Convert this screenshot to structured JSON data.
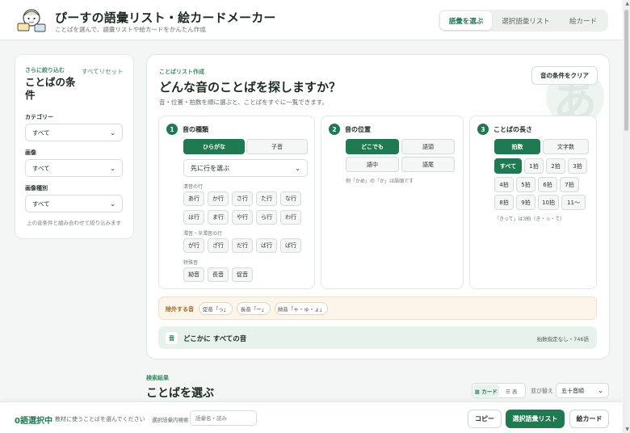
{
  "header": {
    "title": "ぴーすの語彙リスト・絵カードメーカー",
    "subtitle": "ことばを選んで、語彙リストや絵カードをかんたん作成",
    "tabs": [
      {
        "label": "語彙を選ぶ",
        "active": true
      },
      {
        "label": "選択語彙リスト",
        "active": false
      },
      {
        "label": "絵カード",
        "active": false
      }
    ]
  },
  "filters": {
    "eyebrow": "さらに絞り込む",
    "title": "ことばの条件",
    "reset_label": "すべてリセット",
    "category_label": "カテゴリー",
    "category_value": "すべて",
    "image_label": "画像",
    "image_value": "すべて",
    "image_type_label": "画像種別",
    "image_type_value": "すべて",
    "hint": "上の音条件と組み合わせて絞り込みます"
  },
  "main": {
    "eyebrow": "ことばリスト作成",
    "title": "どんな音のことばを探しますか？",
    "description": "音・位置・拍数を順に選ぶと、ことばをすぐに一覧できます。",
    "clear_label": "音の条件をクリア",
    "watermark": "あ"
  },
  "step1": {
    "number": "1",
    "title": "音の種類",
    "toggle": [
      "ひらがな",
      "子音"
    ],
    "row_select_value": "先に行を選ぶ",
    "group1_label": "清音の行",
    "group1": [
      "あ行",
      "か行",
      "さ行",
      "た行",
      "な行",
      "は行",
      "ま行",
      "や行",
      "ら行",
      "わ行"
    ],
    "group2_label": "濁音・半濁音の行",
    "group2": [
      "が行",
      "ざ行",
      "だ行",
      "ば行",
      "ぱ行"
    ],
    "group3_label": "特殊音",
    "group3": [
      "拗音",
      "長音",
      "促音"
    ]
  },
  "step2": {
    "number": "2",
    "title": "音の位置",
    "options": [
      "どこでも",
      "語頭",
      "語中",
      "語尾"
    ],
    "note": "例「かめ」の「か」は語頭です"
  },
  "step3": {
    "number": "3",
    "title": "ことばの長さ",
    "toggle": [
      "拍数",
      "文字数"
    ],
    "counts": [
      "すべて",
      "1拍",
      "2拍",
      "3拍",
      "4拍",
      "5拍",
      "6拍",
      "7拍",
      "8拍",
      "9拍",
      "10拍",
      "11〜"
    ],
    "note": "「きって」は3拍（き・っ・て）"
  },
  "exclude": {
    "label": "除外する音",
    "chips": [
      "促音「っ」",
      "長音「ー」",
      "拗音「ゃ・ゅ・ょ」"
    ]
  },
  "summary": {
    "icon": "音",
    "text": "どこかに すべての音",
    "meta": "拍数指定なし・746語"
  },
  "results": {
    "eyebrow": "検索結果",
    "title": "ことばを選ぶ",
    "view_card": "▦ カード",
    "view_table": "☰ 表",
    "sort_label": "並び替え",
    "sort_value": "五十音順"
  },
  "bottom": {
    "selected_count": "0語選択中",
    "hint": "教材に使うことばを選んでください",
    "search_label": "選択語彙内検索",
    "search_placeholder": "語彙名・読み",
    "copy_label": "コピー",
    "list_label": "選択語彙リスト",
    "cards_label": "絵カード"
  },
  "colors": {
    "accent": "#1f7a52",
    "accent_light": "#e8f2ec",
    "exclude_bg": "#fdf5ea"
  }
}
